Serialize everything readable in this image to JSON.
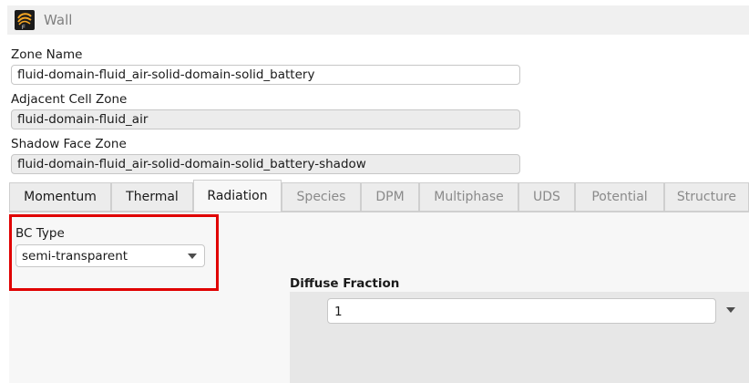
{
  "window": {
    "title": "Wall",
    "icon": "fluent-app-icon"
  },
  "fields": {
    "zone_name": {
      "label": "Zone Name",
      "value": "fluid-domain-fluid_air-solid-domain-solid_battery"
    },
    "adjacent_cell_zone": {
      "label": "Adjacent Cell Zone",
      "value": "fluid-domain-fluid_air"
    },
    "shadow_face_zone": {
      "label": "Shadow Face Zone",
      "value": "fluid-domain-fluid_air-solid-domain-solid_battery-shadow"
    }
  },
  "tabs": [
    {
      "label": "Momentum",
      "state": "enabled"
    },
    {
      "label": "Thermal",
      "state": "enabled"
    },
    {
      "label": "Radiation",
      "state": "active"
    },
    {
      "label": "Species",
      "state": "disabled"
    },
    {
      "label": "DPM",
      "state": "disabled"
    },
    {
      "label": "Multiphase",
      "state": "disabled"
    },
    {
      "label": "UDS",
      "state": "disabled"
    },
    {
      "label": "Potential",
      "state": "disabled"
    },
    {
      "label": "Structure",
      "state": "disabled"
    }
  ],
  "radiation": {
    "bc_type": {
      "label": "BC Type",
      "selected": "semi-transparent"
    },
    "diffuse_fraction": {
      "label": "Diffuse Fraction",
      "value": "1"
    }
  },
  "colors": {
    "highlight": "#e00000",
    "icon_orange": "#f5a623"
  }
}
